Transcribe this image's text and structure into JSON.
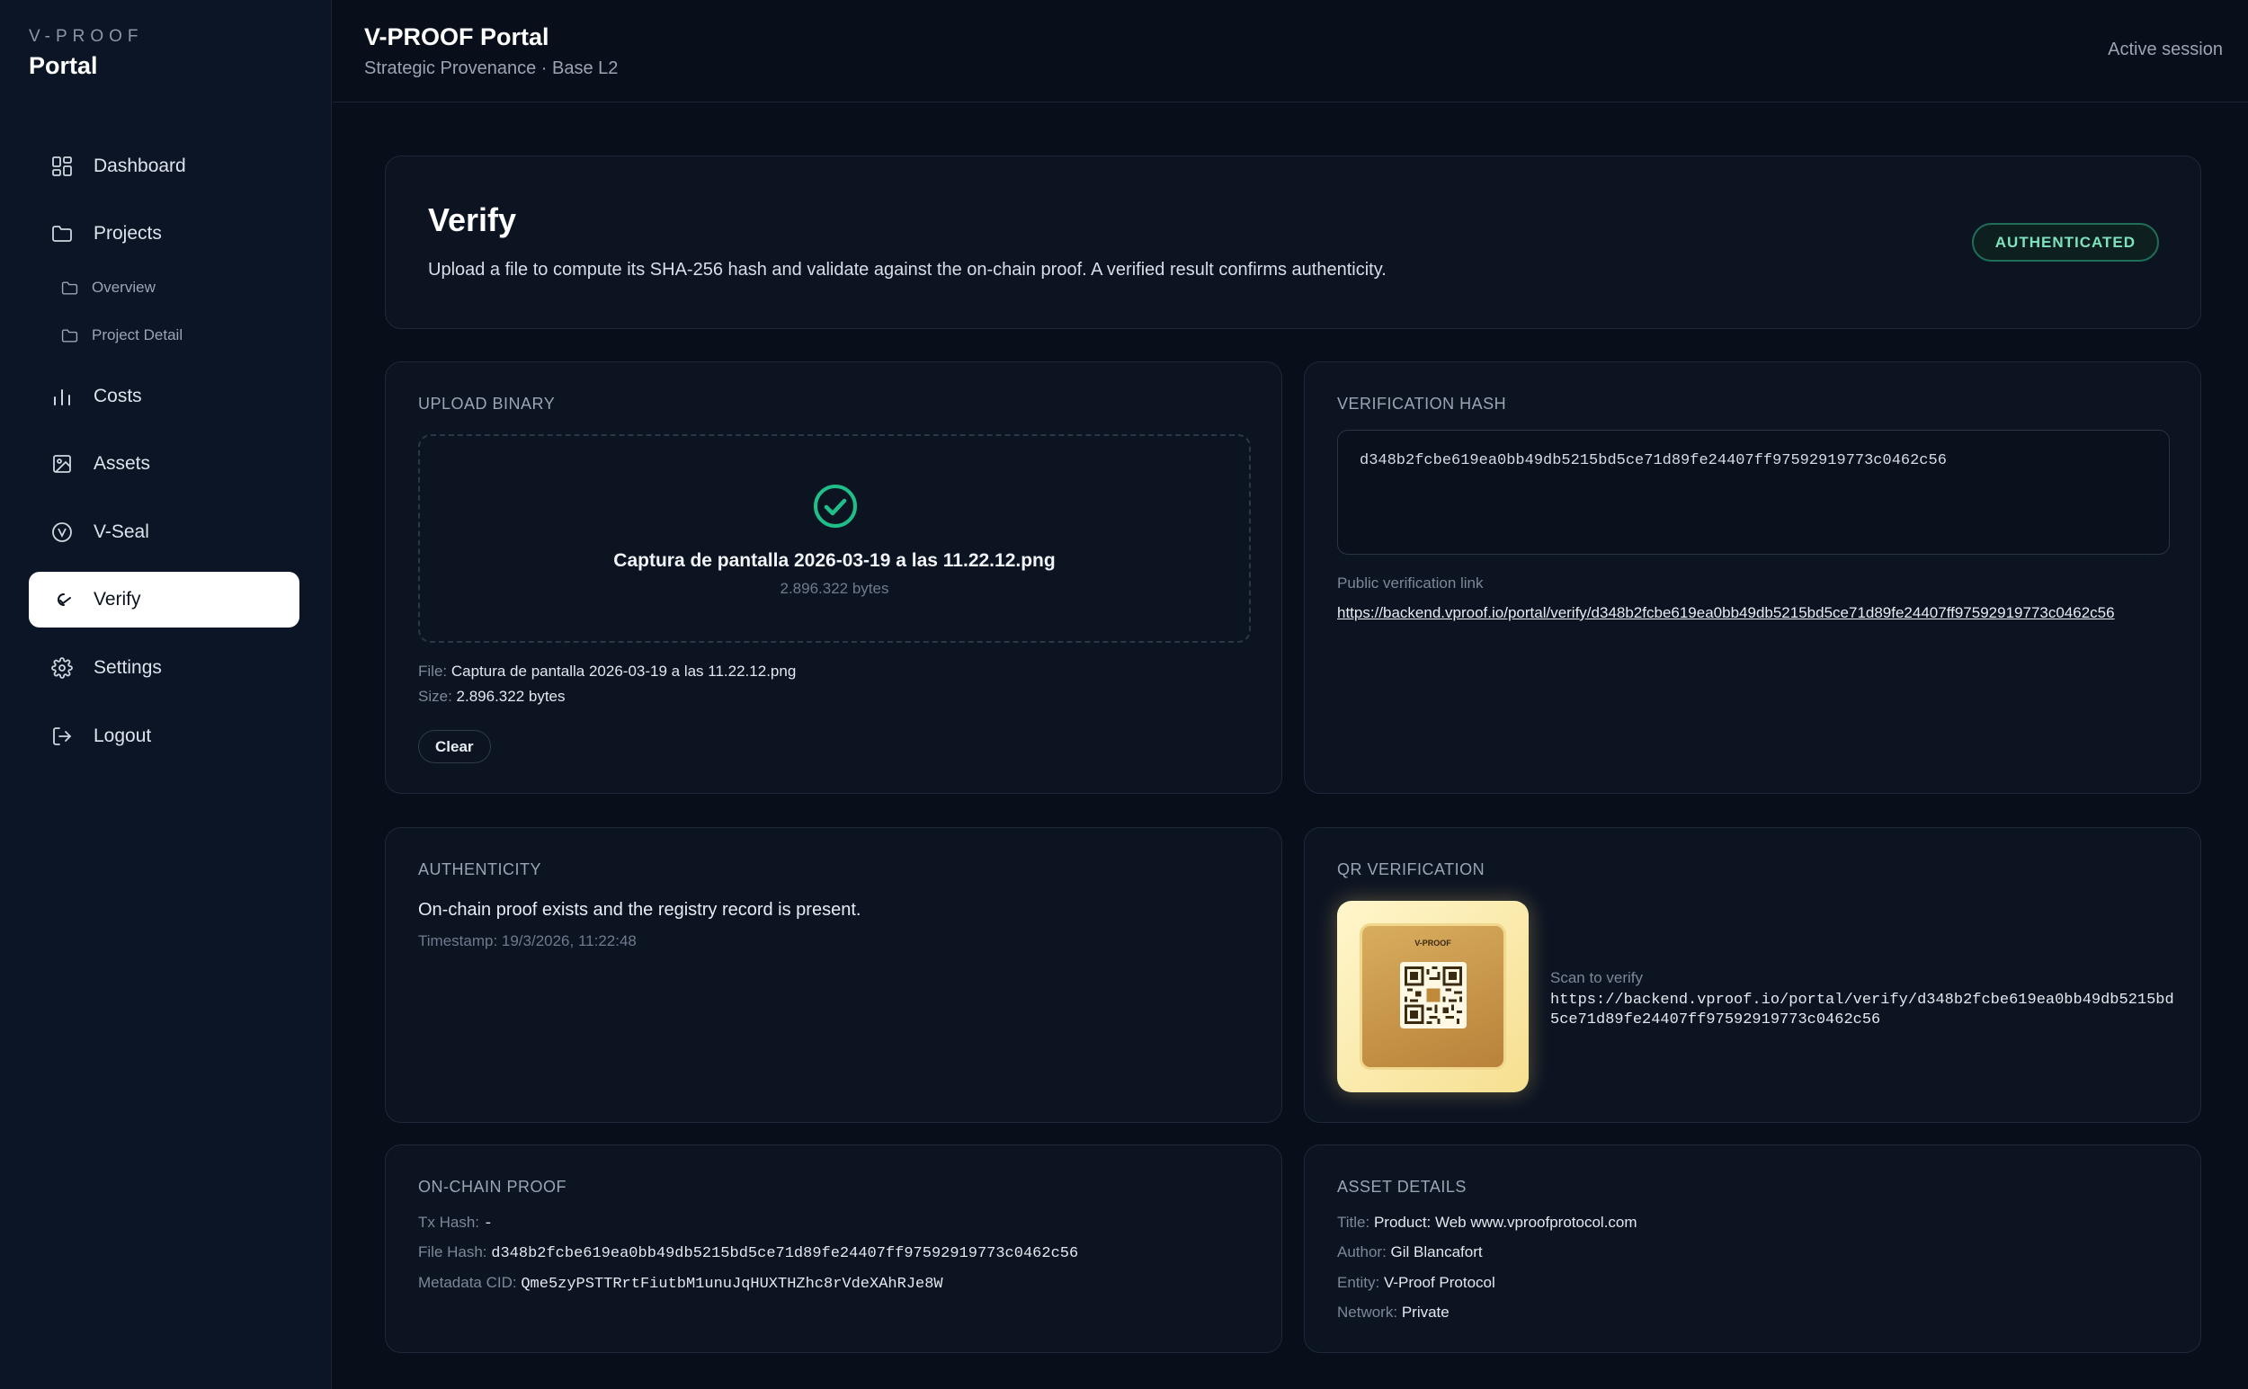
{
  "brand": {
    "small": "V-PROOF",
    "big": "Portal"
  },
  "nav": {
    "dashboard": "Dashboard",
    "projects": "Projects",
    "overview": "Overview",
    "project_detail": "Project Detail",
    "costs": "Costs",
    "assets": "Assets",
    "vseal": "V-Seal",
    "verify": "Verify",
    "settings": "Settings",
    "logout": "Logout"
  },
  "header": {
    "title": "V-PROOF Portal",
    "subtitle": "Strategic Provenance · Base L2",
    "session": "Active session"
  },
  "verify": {
    "title": "Verify",
    "description": "Upload a file to compute its SHA-256 hash and validate against the on-chain proof. A verified result confirms authenticity.",
    "status_badge": "AUTHENTICATED"
  },
  "upload": {
    "label": "UPLOAD BINARY",
    "file_name": "Captura de pantalla 2026-03-19 a las 11.22.12.png",
    "file_size": "2.896.322 bytes",
    "file_key": "File:",
    "size_key": "Size:",
    "clear_label": "Clear"
  },
  "hash": {
    "label": "VERIFICATION HASH",
    "value": "d348b2fcbe619ea0bb49db5215bd5ce71d89fe24407ff97592919773c0462c56",
    "public_link_label": "Public verification link",
    "public_link": "https://backend.vproof.io/portal/verify/d348b2fcbe619ea0bb49db5215bd5ce71d89fe24407ff97592919773c0462c56"
  },
  "authenticity": {
    "label": "AUTHENTICITY",
    "message": "On-chain proof exists and the registry record is present.",
    "timestamp": "Timestamp: 19/3/2026, 11:22:48"
  },
  "qr": {
    "label": "QR VERIFICATION",
    "brand": "V-PROOF",
    "scan_label": "Scan to verify",
    "url": "https://backend.vproof.io/portal/verify/d348b2fcbe619ea0bb49db5215bd5ce71d89fe24407ff97592919773c0462c56"
  },
  "onchain": {
    "label": "ON-CHAIN PROOF",
    "tx_key": "Tx Hash:",
    "tx_value": "-",
    "file_hash_key": "File Hash:",
    "file_hash_value": "d348b2fcbe619ea0bb49db5215bd5ce71d89fe24407ff97592919773c0462c56",
    "cid_key": "Metadata CID:",
    "cid_value": "Qme5zyPSTTRrtFiutbM1unuJqHUXTHZhc8rVdeXAhRJe8W"
  },
  "asset": {
    "label": "ASSET DETAILS",
    "title_key": "Title:",
    "title_value": "Product: Web www.vproofprotocol.com",
    "author_key": "Author:",
    "author_value": "Gil Blancafort",
    "entity_key": "Entity:",
    "entity_value": "V-Proof Protocol",
    "network_key": "Network:",
    "network_value": "Private"
  },
  "colors": {
    "background": "#090f1a",
    "sidebar": "#0c1525",
    "card": "#0c1422",
    "accent_green": "#1fbf8a",
    "badge_text": "#7ee2bf"
  },
  "icons": {
    "dashboard": "grid-icon",
    "projects": "folder-icon",
    "costs": "bar-chart-icon",
    "assets": "image-icon",
    "vseal": "seal-icon",
    "verify": "signature-icon",
    "settings": "gear-icon",
    "logout": "logout-icon",
    "upload_success": "check-circle-icon"
  }
}
